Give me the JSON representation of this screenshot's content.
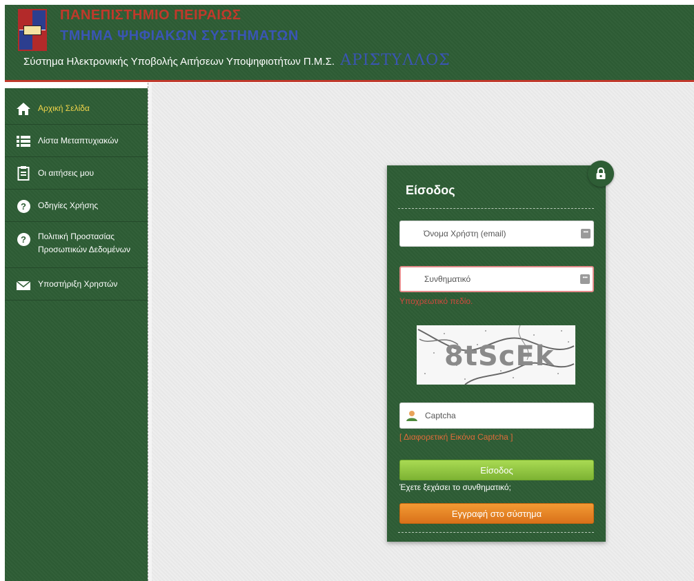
{
  "header": {
    "university": "ΠΑΝΕΠΙΣΤΗΜΙΟ ΠΕΙΡΑΙΩΣ",
    "department": "ΤΜΗΜΑ ΨΗΦΙΑΚΩΝ ΣΥΣΤΗΜΑΤΩΝ",
    "system_title": "Σύστημα Ηλεκτρονικής Υποβολής Αιτήσεων Υποψηφιοτήτων Π.Μ.Σ.",
    "brand": "ΑΡΙΣΤΥΛΛΟΣ"
  },
  "sidebar": {
    "items": [
      {
        "label": "Αρχική Σελίδα",
        "icon": "home-icon",
        "active": true
      },
      {
        "label": "Λίστα Μεταπτυχιακών",
        "icon": "list-icon"
      },
      {
        "label": "Οι αιτήσεις μου",
        "icon": "clipboard-icon"
      },
      {
        "label": "Οδηγίες Χρήσης",
        "icon": "question-icon"
      },
      {
        "label_line1": "Πολιτική Προστασίας",
        "label_line2": "Προσωπικών Δεδομένων",
        "icon": "question-icon"
      },
      {
        "label": "Υποστήριξη Χρηστών",
        "icon": "envelope-icon"
      }
    ]
  },
  "login": {
    "title": "Είσοδος",
    "username_placeholder": "Όνομα Χρήστη (email)",
    "password_placeholder": "Συνθηματικό",
    "required_error": "Υποχρεωτικό πεδίο.",
    "captcha_text": "8tScEk",
    "captcha_placeholder": "Captcha",
    "captcha_refresh": "[ Διαφορετική Εικόνα Captcha ]",
    "submit_label": "Είσοδος",
    "forgot_password": "Έχετε ξεχάσει το συνθηματικό;",
    "register_label": "Εγγραφή στο σύστημα"
  },
  "colors": {
    "panel_green": "#2e5d35",
    "accent_red": "#c0392b",
    "accent_blue": "#3a55b4",
    "active_yellow": "#f1d54a",
    "login_button": "#8cc63f",
    "register_button": "#e67e22"
  }
}
